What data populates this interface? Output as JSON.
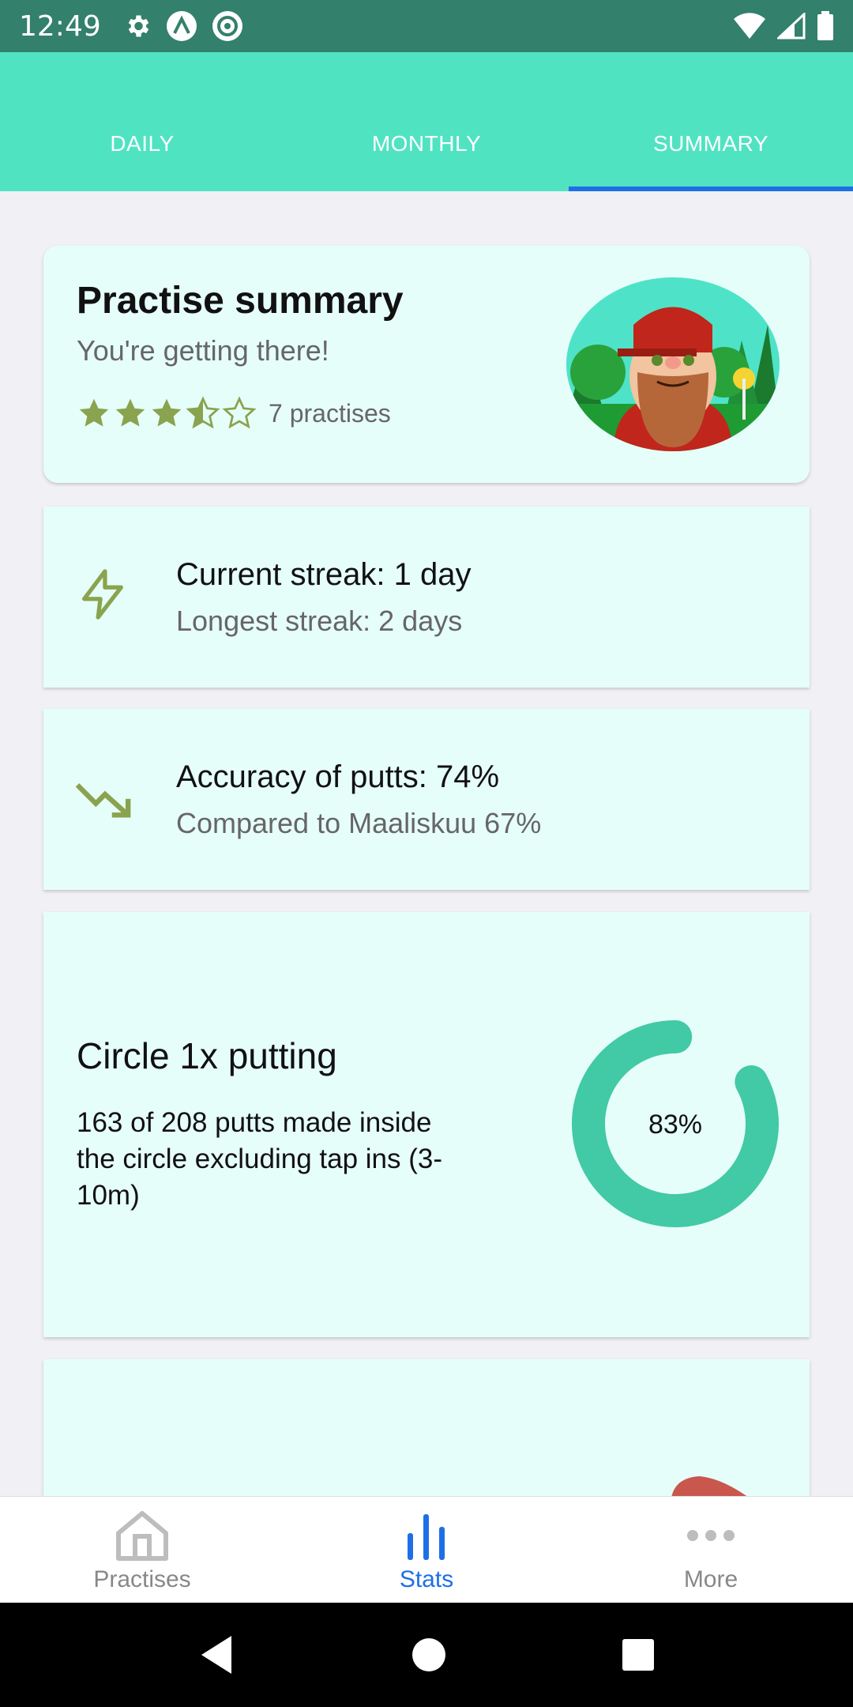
{
  "status_bar": {
    "time": "12:49"
  },
  "tabs": [
    {
      "label": "DAILY",
      "active": false
    },
    {
      "label": "MONTHLY",
      "active": false
    },
    {
      "label": "SUMMARY",
      "active": true
    }
  ],
  "summary": {
    "title": "Practise summary",
    "subtitle": "You're getting there!",
    "rating": 3.5,
    "rating_max": 5,
    "practises_text": "7 practises"
  },
  "streak": {
    "icon": "lightning-icon",
    "current": "Current streak: 1 day",
    "longest": "Longest streak: 2 days"
  },
  "accuracy": {
    "icon": "trending-down-icon",
    "title": "Accuracy of putts: 74%",
    "compare": "Compared to Maaliskuu 67%"
  },
  "circle": {
    "title": "Circle 1x putting",
    "description": "163 of 208 putts made inside the circle excluding tap ins (3-10m)",
    "percent_label": "83%",
    "percent_value": 83
  },
  "bottom_nav": [
    {
      "label": "Practises",
      "icon": "home-icon",
      "active": false
    },
    {
      "label": "Stats",
      "icon": "bar-chart-icon",
      "active": true
    },
    {
      "label": "More",
      "icon": "more-dots-icon",
      "active": false
    }
  ],
  "colors": {
    "accent": "#50e3c2",
    "status_bar": "#33806c",
    "tab_indicator": "#1e6fe6",
    "card_bg": "#e6fefa",
    "icon_olive": "#8aa34e",
    "donut": "#42c9a6"
  }
}
